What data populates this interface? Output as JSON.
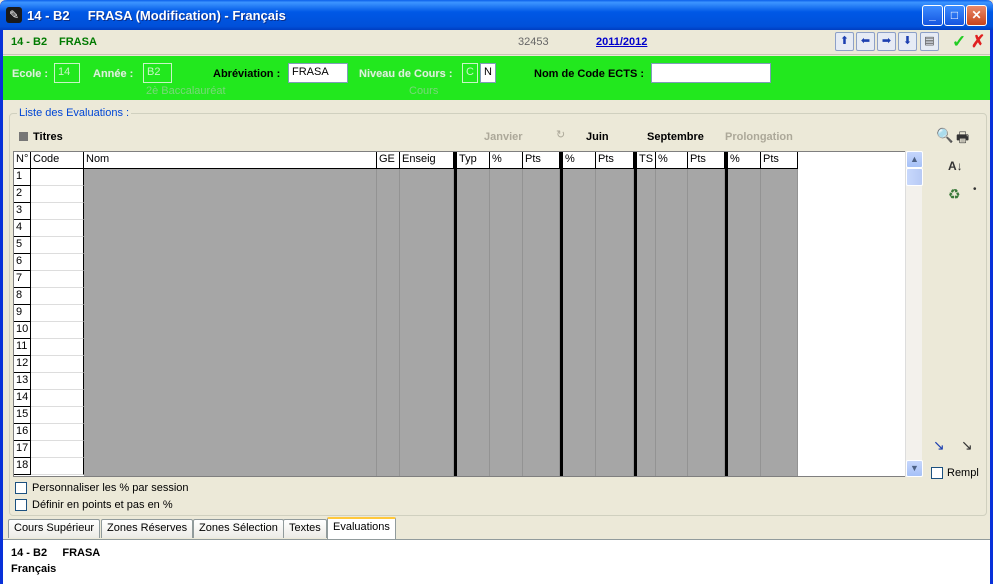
{
  "window": {
    "title": "14 - B2     FRASA (Modification) - Français",
    "minimize": "_",
    "maximize": "□",
    "close": "✕"
  },
  "toolbar": {
    "code": "14 - B2",
    "name": "FRASA",
    "number": "32453",
    "year": "2011/2012",
    "nav_icons": [
      "first-icon",
      "prev-icon",
      "next-icon",
      "last-icon",
      "notes-icon"
    ],
    "ok_glyph": "✓",
    "cancel_glyph": "✗",
    "ok_color": "#22CC22",
    "cancel_color": "#E02020"
  },
  "form": {
    "ecole_label": "Ecole :",
    "ecole_value": "14",
    "annee_label": "Année :",
    "annee_value": "B2",
    "annee_sub": "2è Baccalauréat",
    "abrev_label": "Abréviation :",
    "abrev_value": "FRASA",
    "niveau_label": "Niveau de Cours :",
    "niveau_value1": "C",
    "niveau_value2": "N",
    "niveau_sub": "Cours",
    "ects_label": "Nom de Code ECTS :",
    "ects_value": "",
    "band_color": "#22E81E"
  },
  "evaluations": {
    "legend": "Liste des Evaluations :",
    "titres": "Titres",
    "sessions": {
      "janvier": "Janvier",
      "juin": "Juin",
      "septembre": "Septembre",
      "prolongation": "Prolongation"
    },
    "columns": {
      "num": "N°",
      "code": "Code",
      "nom": "Nom",
      "ge": "GE",
      "enseig": "Enseig",
      "typ": "Typ",
      "pct": "%",
      "pts": "Pts",
      "pct2": "%",
      "pts2": "Pts",
      "ts": "TS",
      "pct3": "%",
      "pts3": "Pts",
      "pct4": "%",
      "pts4": "Pts"
    },
    "rows": [
      "1",
      "2",
      "3",
      "4",
      "5",
      "6",
      "7",
      "8",
      "9",
      "10",
      "11",
      "12",
      "13",
      "14",
      "15",
      "16",
      "17",
      "18"
    ],
    "scroll_up": "▲",
    "scroll_down": "▼",
    "checkbox1": "Personnaliser les % par session",
    "checkbox2": "Définir en points et pas en %",
    "rempl_label": "Rempl"
  },
  "tabs": [
    "Cours Supérieur",
    "Zones Réserves",
    "Zones Sélection",
    "Textes",
    "Evaluations"
  ],
  "status": {
    "line1": "14 - B2     FRASA",
    "line2": "Français"
  }
}
